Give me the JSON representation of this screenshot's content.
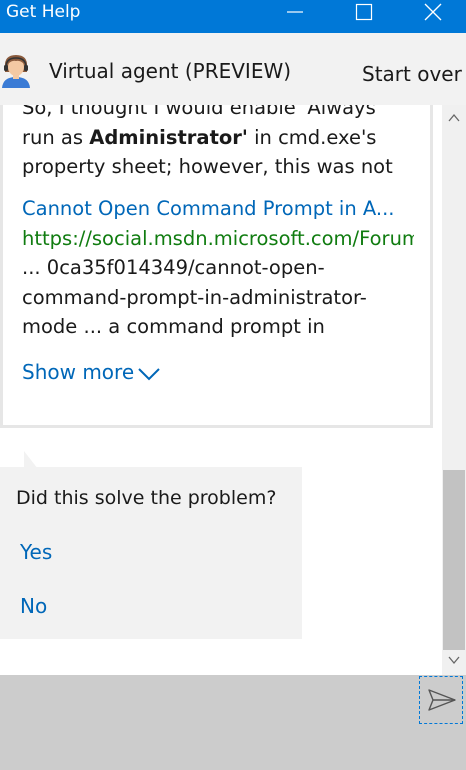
{
  "window": {
    "title": "Get Help",
    "controls": [
      "minimize-icon",
      "maximize-icon",
      "close-icon"
    ]
  },
  "header": {
    "agent_name": "Virtual agent (PREVIEW)",
    "start_over": "Start over",
    "avatar_icon": "agent-avatar-icon"
  },
  "result_card": {
    "snippet_line1": "So, I thought I would enable 'Always",
    "snippet_line2_pre": "run as ",
    "snippet_line2_bold": "Administrator'",
    "snippet_line2_post": " in cmd.exe's",
    "snippet_line3": "property sheet; however, this was not",
    "title": "Cannot Open Command Prompt in A...",
    "url": "https://social.msdn.microsoft.com/Forum",
    "description_line1": "... 0ca35f014349/cannot-open-",
    "description_line2": "command-prompt-in-administrator-",
    "description_line3": "mode ... a command prompt in",
    "show_more": "Show more"
  },
  "question_bubble": {
    "question": "Did this solve the problem?",
    "yes": "Yes",
    "no": "No"
  },
  "composer": {
    "send_icon": "send-icon"
  },
  "colors": {
    "titlebar": "#0078d7",
    "link": "#0067b8",
    "url": "#107c10",
    "header_bg": "#f2f2f2",
    "input_bg": "#cccccc"
  }
}
